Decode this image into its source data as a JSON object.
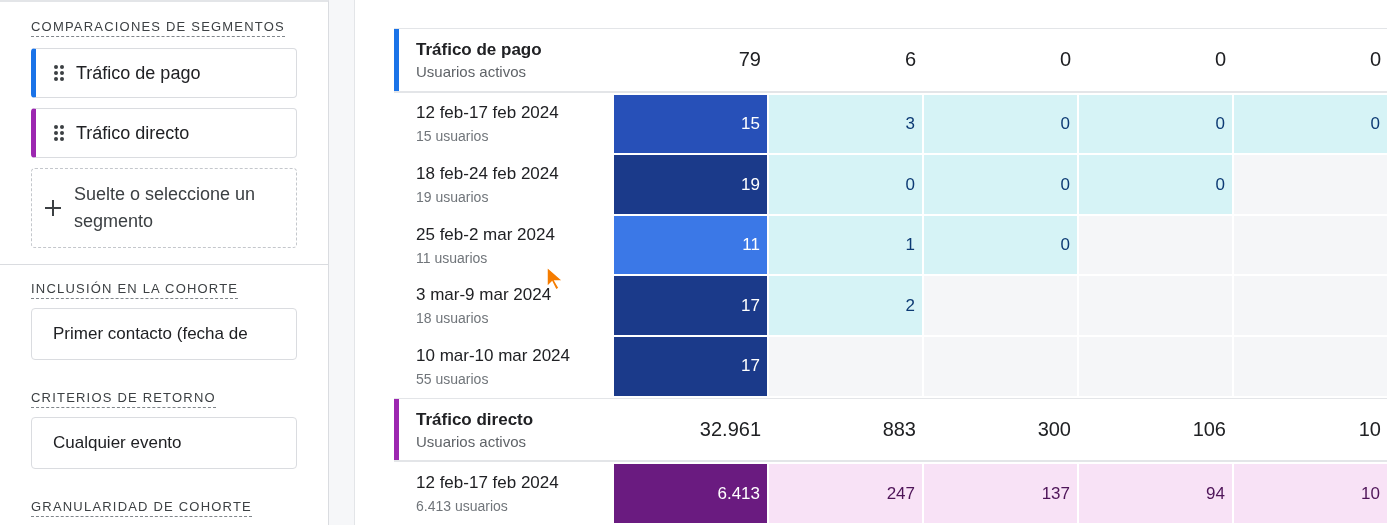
{
  "sidebar": {
    "segment_comparisons": {
      "title": "COMPARACIONES DE SEGMENTOS",
      "segments": [
        {
          "label": "Tráfico de pago",
          "color": "#1a73e8"
        },
        {
          "label": "Tráfico directo",
          "color": "#9c27b0"
        }
      ],
      "drop_zone": {
        "label": "Suelte o seleccione un segmento"
      }
    },
    "settings": [
      {
        "title": "INCLUSIÓN EN LA COHORTE",
        "value": "Primer contacto (fecha de"
      },
      {
        "title": "CRITERIOS DE RETORNO",
        "value": "Cualquier evento"
      },
      {
        "title": "GRANULARIDAD DE COHORTE"
      }
    ]
  },
  "table": {
    "segments": [
      {
        "name": "Tráfico de pago",
        "metric": "Usuarios activos",
        "color": "#1a73e8",
        "totals": [
          "79",
          "6",
          "0",
          "0",
          "0"
        ],
        "rows": [
          {
            "range": "12 feb-17 feb 2024",
            "users": "15 usuarios",
            "cells": [
              {
                "kind": "filled",
                "value": "15",
                "color": "#2750b8"
              },
              {
                "kind": "filled",
                "value": "3",
                "color": "#d6f3f6"
              },
              {
                "kind": "filled",
                "value": "0",
                "color": "#d6f3f6"
              },
              {
                "kind": "filled",
                "value": "0",
                "color": "#d6f3f6"
              },
              {
                "kind": "filled",
                "value": "0",
                "color": "#d6f3f6"
              }
            ]
          },
          {
            "range": "18 feb-24 feb 2024",
            "users": "19 usuarios",
            "cells": [
              {
                "kind": "filled",
                "value": "19",
                "color": "#1b3a8a"
              },
              {
                "kind": "filled",
                "value": "0",
                "color": "#d6f3f6"
              },
              {
                "kind": "filled",
                "value": "0",
                "color": "#d6f3f6"
              },
              {
                "kind": "filled",
                "value": "0",
                "color": "#d6f3f6"
              },
              {
                "kind": "empty"
              }
            ]
          },
          {
            "range": "25 feb-2 mar 2024",
            "users": "11 usuarios",
            "cells": [
              {
                "kind": "filled",
                "value": "11",
                "color": "#3b78e7"
              },
              {
                "kind": "filled",
                "value": "1",
                "color": "#d6f3f6"
              },
              {
                "kind": "filled",
                "value": "0",
                "color": "#d6f3f6"
              },
              {
                "kind": "empty"
              },
              {
                "kind": "empty"
              }
            ]
          },
          {
            "range": "3 mar-9 mar 2024",
            "users": "18 usuarios",
            "cells": [
              {
                "kind": "filled",
                "value": "17",
                "color": "#1b3a8a"
              },
              {
                "kind": "filled",
                "value": "2",
                "color": "#d6f3f6"
              },
              {
                "kind": "empty"
              },
              {
                "kind": "empty"
              },
              {
                "kind": "empty"
              }
            ]
          },
          {
            "range": "10 mar-10 mar 2024",
            "users": "55 usuarios",
            "cells": [
              {
                "kind": "filled",
                "value": "17",
                "color": "#1b3a8a"
              },
              {
                "kind": "empty"
              },
              {
                "kind": "empty"
              },
              {
                "kind": "empty"
              },
              {
                "kind": "empty"
              }
            ]
          }
        ]
      },
      {
        "name": "Tráfico directo",
        "metric": "Usuarios activos",
        "color": "#9c27b0",
        "totals": [
          "32.961",
          "883",
          "300",
          "106",
          "10"
        ],
        "rows": [
          {
            "range": "12 feb-17 feb 2024",
            "users": "6.413 usuarios",
            "cells": [
              {
                "kind": "filled",
                "value": "6.413",
                "color": "#6a1b80"
              },
              {
                "kind": "filled",
                "value": "247",
                "color": "#f8e2f6"
              },
              {
                "kind": "filled",
                "value": "137",
                "color": "#f8e2f6"
              },
              {
                "kind": "filled",
                "value": "94",
                "color": "#f8e2f6"
              },
              {
                "kind": "filled",
                "value": "10",
                "color": "#f8e2f6"
              }
            ]
          }
        ]
      }
    ]
  }
}
